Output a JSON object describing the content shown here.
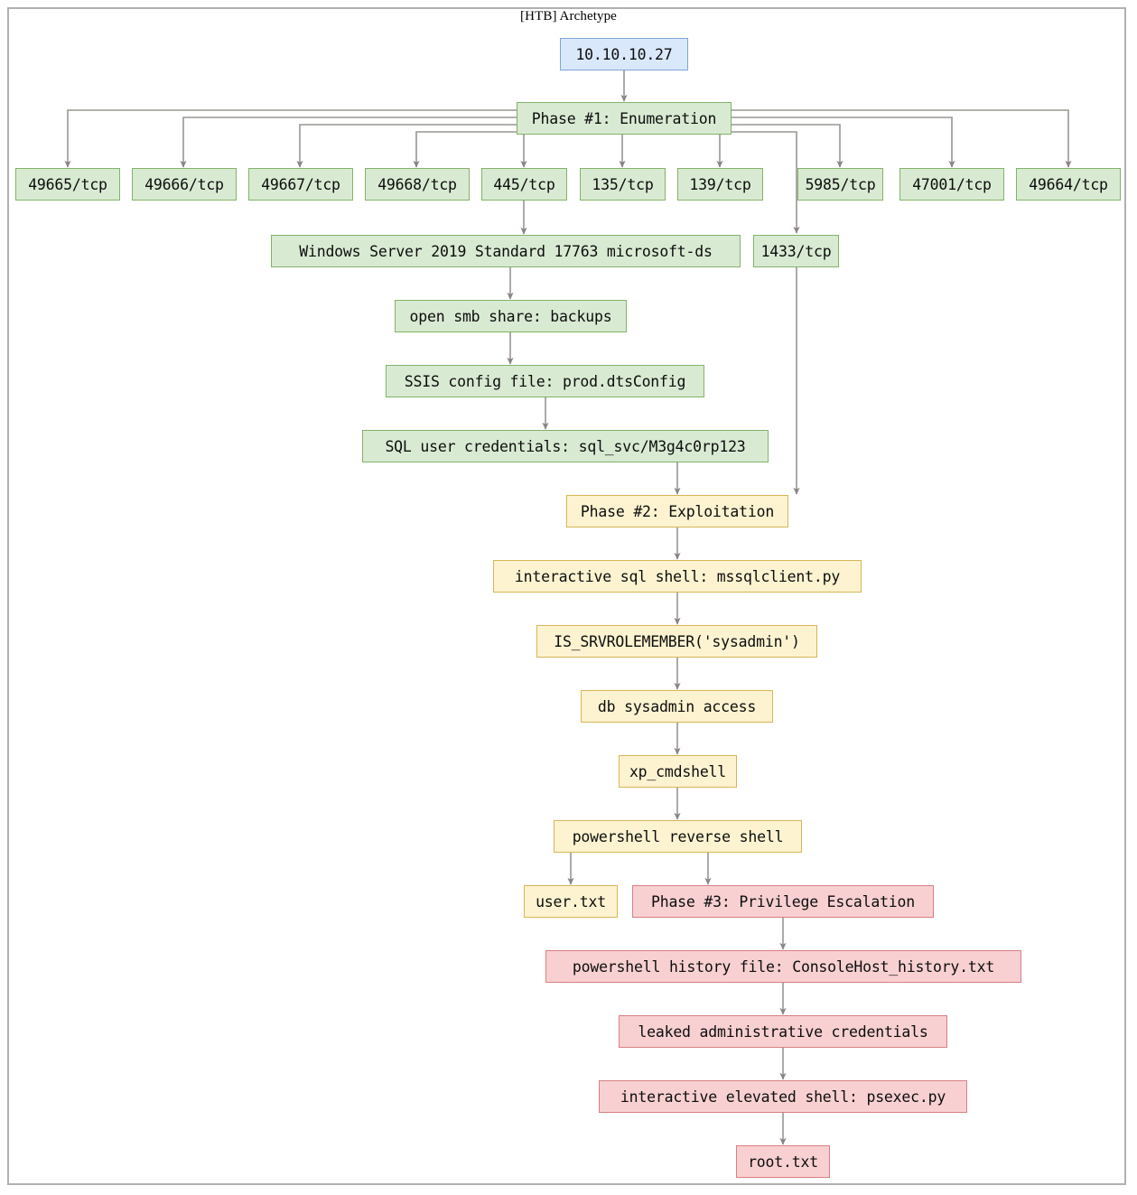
{
  "diagram": {
    "title": "[HTB] Archetype",
    "type": "flowchart",
    "colors": {
      "blue_fill": "#dae8fc",
      "blue_border": "#7ea6d8",
      "green_fill": "#d9ead3",
      "green_border": "#82b366",
      "yellow_fill": "#fdf3d0",
      "yellow_border": "#d6b656",
      "red_fill": "#f8d0d2",
      "red_border": "#d97f82",
      "edge": "#9a9592",
      "frame": "#b3b0ae"
    },
    "nodes": {
      "target": "10.10.10.27",
      "phase1": "Phase #1: Enumeration",
      "port_49665": "49665/tcp",
      "port_49666": "49666/tcp",
      "port_49667": "49667/tcp",
      "port_49668": "49668/tcp",
      "port_445": "445/tcp",
      "port_135": "135/tcp",
      "port_139": "139/tcp",
      "port_5985": "5985/tcp",
      "port_47001": "47001/tcp",
      "port_49664": "49664/tcp",
      "port_1433": "1433/tcp",
      "os_banner": "Windows Server 2019 Standard 17763 microsoft-ds",
      "smb_share": "open smb share: backups",
      "ssis_config": "SSIS config file: prod.dtsConfig",
      "sql_creds": "SQL user credentials: sql_svc/M3g4c0rp123",
      "phase2": "Phase #2: Exploitation",
      "sql_shell": "interactive sql shell: mssqlclient.py",
      "srvrolemember": "IS_SRVROLEMEMBER('sysadmin')",
      "db_sysadmin": "db sysadmin access",
      "xp_cmdshell": "xp_cmdshell",
      "ps_revshell": "powershell reverse shell",
      "user_flag": "user.txt",
      "phase3": "Phase #3: Privilege Escalation",
      "ps_history": "powershell history file: ConsoleHost_history.txt",
      "admin_creds": "leaked administrative credentials",
      "psexec_shell": "interactive elevated shell: psexec.py",
      "root_flag": "root.txt"
    },
    "edges": [
      "10.10.10.27 -> Phase #1: Enumeration",
      "Phase #1: Enumeration -> 49665/tcp",
      "Phase #1: Enumeration -> 49666/tcp",
      "Phase #1: Enumeration -> 49667/tcp",
      "Phase #1: Enumeration -> 49668/tcp",
      "Phase #1: Enumeration -> 445/tcp",
      "Phase #1: Enumeration -> 135/tcp",
      "Phase #1: Enumeration -> 139/tcp",
      "Phase #1: Enumeration -> 5985/tcp",
      "Phase #1: Enumeration -> 47001/tcp",
      "Phase #1: Enumeration -> 49664/tcp",
      "Phase #1: Enumeration -> 1433/tcp",
      "445/tcp -> Windows Server 2019 Standard 17763 microsoft-ds",
      "Windows Server 2019 Standard 17763 microsoft-ds -> open smb share: backups",
      "open smb share: backups -> SSIS config file: prod.dtsConfig",
      "SSIS config file: prod.dtsConfig -> SQL user credentials: sql_svc/M3g4c0rp123",
      "SQL user credentials: sql_svc/M3g4c0rp123 -> Phase #2: Exploitation",
      "1433/tcp -> Phase #2: Exploitation",
      "Phase #2: Exploitation -> interactive sql shell: mssqlclient.py",
      "interactive sql shell: mssqlclient.py -> IS_SRVROLEMEMBER('sysadmin')",
      "IS_SRVROLEMEMBER('sysadmin') -> db sysadmin access",
      "db sysadmin access -> xp_cmdshell",
      "xp_cmdshell -> powershell reverse shell",
      "powershell reverse shell -> user.txt",
      "powershell reverse shell -> Phase #3: Privilege Escalation",
      "Phase #3: Privilege Escalation -> powershell history file: ConsoleHost_history.txt",
      "powershell history file: ConsoleHost_history.txt -> leaked administrative credentials",
      "leaked administrative credentials -> interactive elevated shell: psexec.py",
      "interactive elevated shell: psexec.py -> root.txt"
    ]
  }
}
